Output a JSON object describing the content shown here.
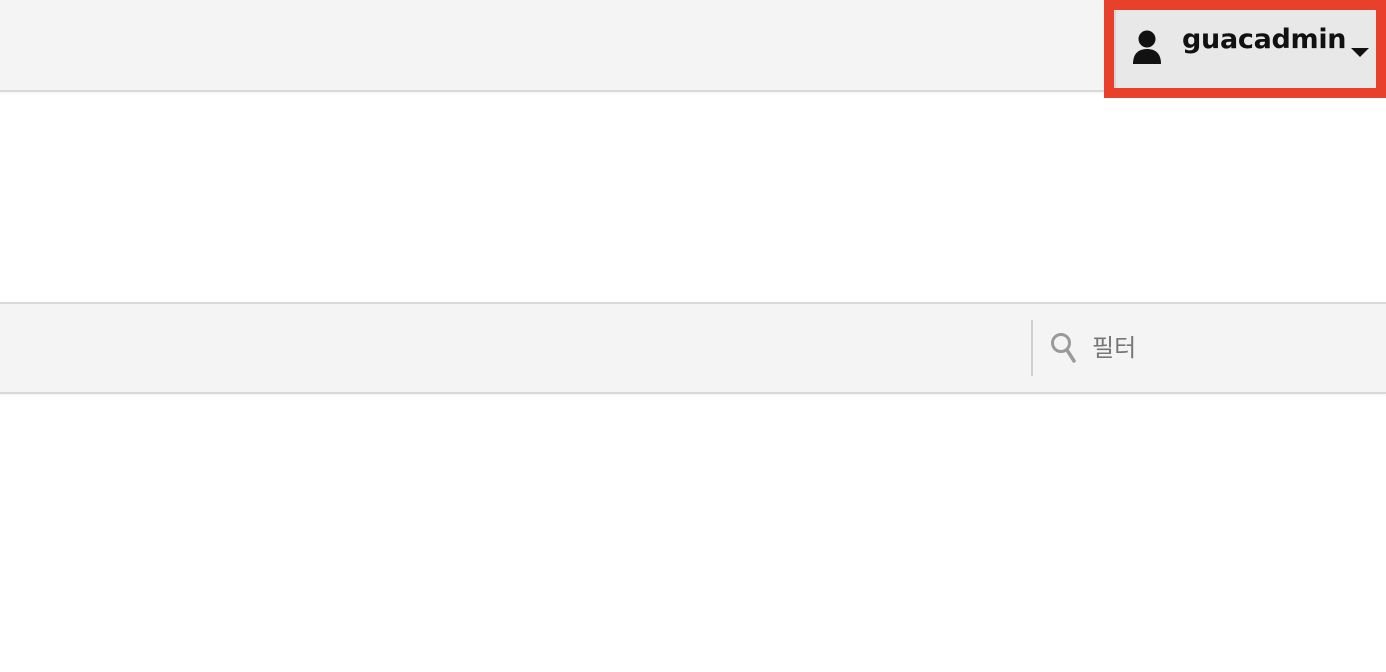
{
  "header": {
    "user_menu": {
      "username": "guacadmin",
      "icon": "user-icon",
      "dropdown_icon": "caret-down-icon",
      "highlight_color": "#e8402a"
    }
  },
  "filter_bar": {
    "search_icon": "search-icon",
    "filter_placeholder": "필터",
    "filter_value": ""
  }
}
